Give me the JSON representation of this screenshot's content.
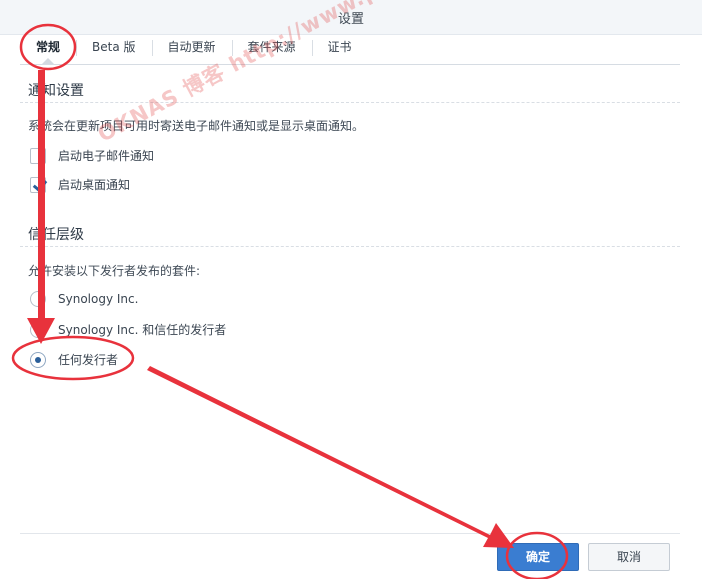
{
  "window": {
    "title": "设置"
  },
  "tabs": [
    {
      "label": "常规",
      "active": true
    },
    {
      "label": "Beta 版",
      "active": false
    },
    {
      "label": "自动更新",
      "active": false
    },
    {
      "label": "套件来源",
      "active": false
    },
    {
      "label": "证书",
      "active": false
    }
  ],
  "notify": {
    "title": "通知设置",
    "description": "系统会在更新项目可用时寄送电子邮件通知或是显示桌面通知。",
    "email_label": "启动电子邮件通知",
    "email_checked": false,
    "desktop_label": "启动桌面通知",
    "desktop_checked": true
  },
  "trust": {
    "title": "信任层级",
    "description": "允许安装以下发行者发布的套件:",
    "options": [
      {
        "label": "Synology Inc.",
        "selected": false
      },
      {
        "label": "Synology Inc. 和信任的发行者",
        "selected": false
      },
      {
        "label": "任何发行者",
        "selected": true
      }
    ]
  },
  "footer": {
    "ok_label": "确定",
    "cancel_label": "取消"
  },
  "watermark": "OKNAS 博客  http://www.pcxnas.com",
  "colors": {
    "accent": "#3a7dd1",
    "annotation": "#e8323c",
    "radio_selected": "#2b5f9a"
  }
}
